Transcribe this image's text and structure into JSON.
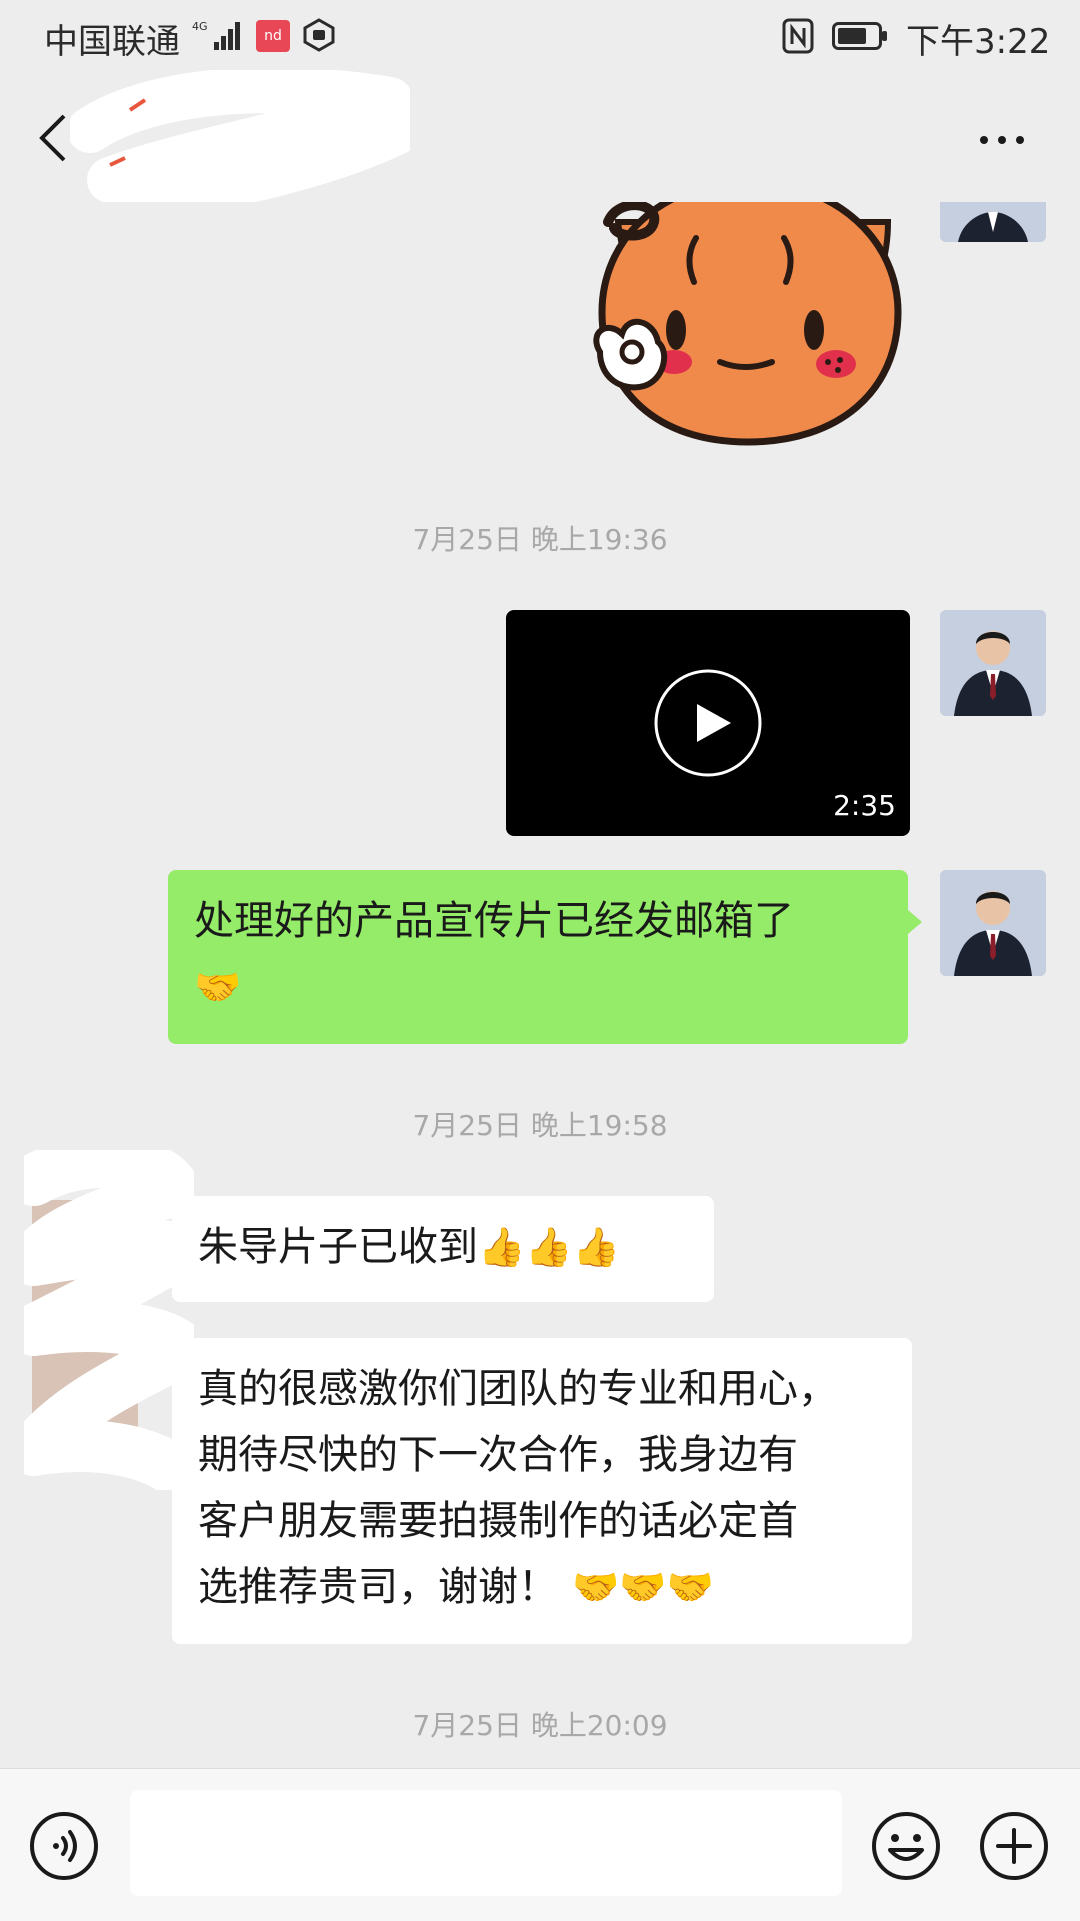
{
  "status_bar": {
    "carrier": "中国联通",
    "network": "4G",
    "app_badge": "nd",
    "clock": "下午3:22"
  },
  "header": {
    "title": "",
    "back_icon": "chevron-left-icon",
    "more_icon": "more-dots-icon"
  },
  "chat": {
    "messages": [
      {
        "type": "sticker",
        "side": "right",
        "description_icon": "ok-gesture-sticker"
      },
      {
        "type": "timestamp",
        "text": "7月25日 晚上19:36"
      },
      {
        "type": "video",
        "side": "right",
        "duration": "2:35"
      },
      {
        "type": "text",
        "side": "right",
        "text_line1": "处理好的产品宣传片已经发邮箱了",
        "emoji": "🤝"
      },
      {
        "type": "timestamp",
        "text": "7月25日 晚上19:58"
      },
      {
        "type": "text",
        "side": "left",
        "text": "朱导片子已收到",
        "emoji": "👍👍👍"
      },
      {
        "type": "text",
        "side": "left",
        "lines": [
          "真的很感激你们团队的专业和用心，",
          "期待尽快的下一次合作，我身边有",
          "客户朋友需要拍摄制作的话必定首",
          "选推荐贵司，谢谢！"
        ],
        "emoji": "🤝🤝🤝"
      },
      {
        "type": "timestamp",
        "text": "7月25日 晚上20:09"
      }
    ]
  },
  "input_bar": {
    "voice_icon": "voice-icon",
    "emoji_icon": "emoji-smile-icon",
    "plus_icon": "plus-icon",
    "value": ""
  },
  "colors": {
    "background": "#ededed",
    "outgoing_bubble": "#95ec69",
    "incoming_bubble": "#ffffff",
    "timestamp": "#a8a8a8"
  }
}
